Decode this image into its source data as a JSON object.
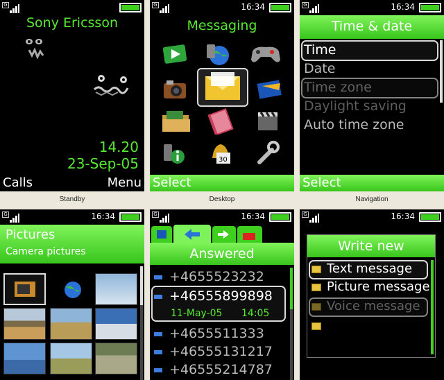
{
  "standby": {
    "status_time": "",
    "brand": "Sony Ericsson",
    "clock": "14.20",
    "date": "23-Sep-05",
    "left_soft": "Calls",
    "right_soft": "Menu",
    "caption": "Standby"
  },
  "desktop": {
    "status_time": "16:34",
    "title": "Messaging",
    "left_soft": "Select",
    "caption": "Desktop",
    "icons": [
      "media-player",
      "internet",
      "games",
      "camera",
      "messaging",
      "entertainment",
      "file-manager",
      "phonebook",
      "video",
      "info",
      "alarms",
      "settings"
    ]
  },
  "navigation": {
    "status_time": "16:34",
    "title": "Time & date",
    "items": [
      "Time",
      "Date",
      "Time zone",
      "Daylight saving",
      "Auto time zone"
    ],
    "left_soft": "Select",
    "caption": "Navigation"
  },
  "pictures": {
    "status_time": "16:34",
    "title": "Pictures",
    "subtitle": "Camera pictures"
  },
  "calls": {
    "status_time": "16:34",
    "title": "Answered",
    "numbers": [
      "+4655523232",
      "+46555899898",
      "+4655511333",
      "+46555131217",
      "+46555214787"
    ],
    "selected_date": "11-May-05",
    "selected_time": "14:05"
  },
  "write": {
    "status_time": "16:34",
    "title": "Write new",
    "items": [
      "Text message",
      "Picture message",
      "Voice message",
      ""
    ]
  },
  "colors": {
    "accent": "#58e832",
    "bar": "#3ecf1f",
    "background": "#000000"
  }
}
